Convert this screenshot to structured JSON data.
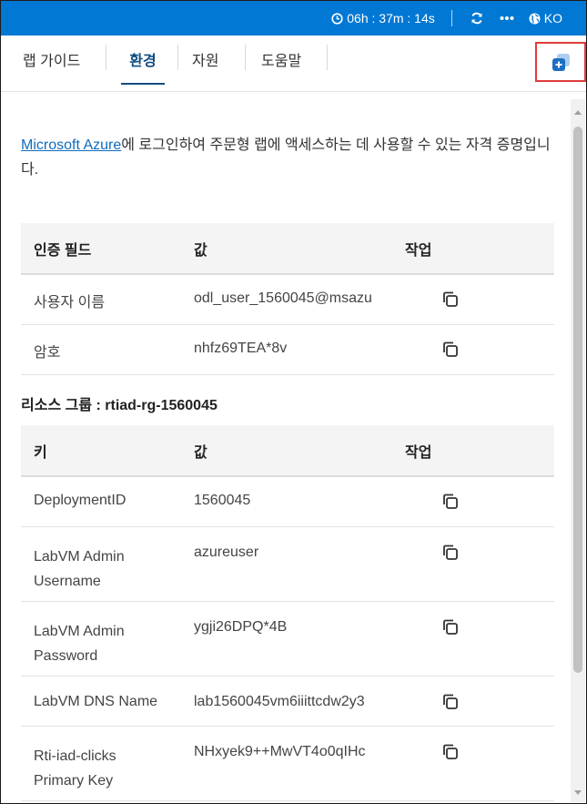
{
  "topbar": {
    "timer": "06h : 37m : 14s",
    "language": "KO",
    "icons": [
      "clock-icon",
      "refresh-icon",
      "more-icon",
      "globe-icon"
    ]
  },
  "tabs": [
    {
      "label": "랩 가이드"
    },
    {
      "label": "환경"
    },
    {
      "label": "자원"
    },
    {
      "label": "도움말"
    }
  ],
  "intro": {
    "link": "Microsoft Azure",
    "text": "에 로그인하여 주문형 랩에 액세스하는 데 사용할 수 있는 자격 증명입니다."
  },
  "credentials": {
    "headers": [
      "인증 필드",
      "값",
      "작업"
    ],
    "rows": [
      {
        "field": "사용자 이름",
        "value": "odl_user_1560045@msazu"
      },
      {
        "field": "암호",
        "value": "nhfz69TEA*8v"
      }
    ]
  },
  "resource_group": {
    "label": "리소스 그룹 : rtiad-rg-1560045",
    "headers": [
      "키",
      "값",
      "작업"
    ],
    "rows": [
      {
        "key": "DeploymentID",
        "value": "1560045"
      },
      {
        "key": "LabVM Admin Username",
        "value": "azureuser"
      },
      {
        "key": "LabVM Admin Password",
        "value": "ygji26DPQ*4B"
      },
      {
        "key": "LabVM DNS Name",
        "value": "lab1560045vm6iiittcdw2y3"
      },
      {
        "key": "Rti-iad-clicks Primary Key",
        "value": "NHxyek9++MwVT4o0qIHc"
      }
    ]
  },
  "colors": {
    "topbar": "#0078d4",
    "active_tab": "#0f4c81",
    "highlight": "#e03b3b",
    "link": "#0f6cbd"
  }
}
